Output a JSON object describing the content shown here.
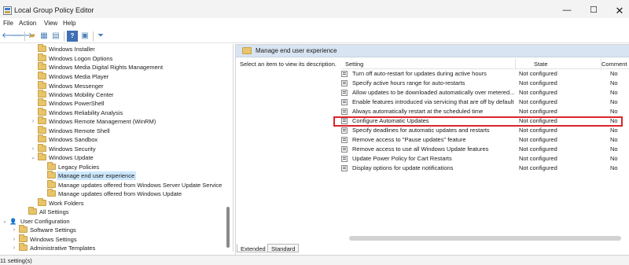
{
  "window": {
    "title": "Local Group Policy Editor",
    "controls": {
      "minimize": "—",
      "maximize": "☐",
      "close": "✕"
    }
  },
  "menubar": [
    "File",
    "Action",
    "View",
    "Help"
  ],
  "toolbar": {
    "icons": [
      "back-arrow-icon",
      "forward-arrow-icon",
      "up-folder-icon",
      "show-hide-tree-icon",
      "export-list-icon",
      "help-icon",
      "properties-icon",
      "filter-icon"
    ]
  },
  "tree": {
    "items": [
      {
        "label": "Windows Installer",
        "expander": ""
      },
      {
        "label": "Windows Logon Options",
        "expander": ""
      },
      {
        "label": "Windows Media Digital Rights Management",
        "expander": ""
      },
      {
        "label": "Windows Media Player",
        "expander": ""
      },
      {
        "label": "Windows Messenger",
        "expander": ""
      },
      {
        "label": "Windows Mobility Center",
        "expander": ""
      },
      {
        "label": "Windows PowerShell",
        "expander": ""
      },
      {
        "label": "Windows Reliability Analysis",
        "expander": ""
      },
      {
        "label": "Windows Remote Management (WinRM)",
        "expander": "›"
      },
      {
        "label": "Windows Remote Shell",
        "expander": ""
      },
      {
        "label": "Windows Sandbox",
        "expander": ""
      },
      {
        "label": "Windows Security",
        "expander": "›"
      },
      {
        "label": "Windows Update",
        "expander": "⌄"
      },
      {
        "label": "Legacy Policies",
        "expander": ""
      },
      {
        "label": "Manage end user experience",
        "expander": "",
        "selected": true
      },
      {
        "label": "Manage updates offered from Windows Server Update Service",
        "expander": ""
      },
      {
        "label": "Manage updates offered from Windows Update",
        "expander": ""
      },
      {
        "label": "Work Folders",
        "expander": ""
      },
      {
        "label": "All Settings",
        "expander": ""
      },
      {
        "label": "User Configuration",
        "expander": "⌄"
      },
      {
        "label": "Software Settings",
        "expander": "›"
      },
      {
        "label": "Windows Settings",
        "expander": "›"
      },
      {
        "label": "Administrative Templates",
        "expander": "›"
      }
    ]
  },
  "right": {
    "header_title": "Manage end user experience",
    "description": "Select an item to view its description.",
    "columns": {
      "setting": "Setting",
      "state": "State",
      "comment": "Comment"
    },
    "rows": [
      {
        "setting": "Turn off auto-restart for updates during active hours",
        "state": "Not configured",
        "comment": "No"
      },
      {
        "setting": "Specify active hours range for auto-restarts",
        "state": "Not configured",
        "comment": "No"
      },
      {
        "setting": "Allow updates to be downloaded automatically over metered...",
        "state": "Not configured",
        "comment": "No"
      },
      {
        "setting": "Enable features introduced via servicing that are off by default",
        "state": "Not configured",
        "comment": "No"
      },
      {
        "setting": "Always automatically restart at the scheduled time",
        "state": "Not configured",
        "comment": "No"
      },
      {
        "setting": "Configure Automatic Updates",
        "state": "Not configured",
        "comment": "No",
        "highlighted": true
      },
      {
        "setting": "Specify deadlines for automatic updates and restarts",
        "state": "Not configured",
        "comment": "No"
      },
      {
        "setting": "Remove access to \"Pause updates\" feature",
        "state": "Not configured",
        "comment": "No"
      },
      {
        "setting": "Remove access to use all Windows Update features",
        "state": "Not configured",
        "comment": "No"
      },
      {
        "setting": "Update Power Policy for Cart Restarts",
        "state": "Not configured",
        "comment": "No"
      },
      {
        "setting": "Display options for update notifications",
        "state": "Not configured",
        "comment": "No"
      }
    ],
    "tabs": [
      "Extended",
      "Standard"
    ]
  },
  "status": {
    "text": "11 setting(s)"
  },
  "colors": {
    "highlight_box": "#d9262c",
    "selection": "#cce8ff",
    "header_band": "#d9e4f2"
  }
}
